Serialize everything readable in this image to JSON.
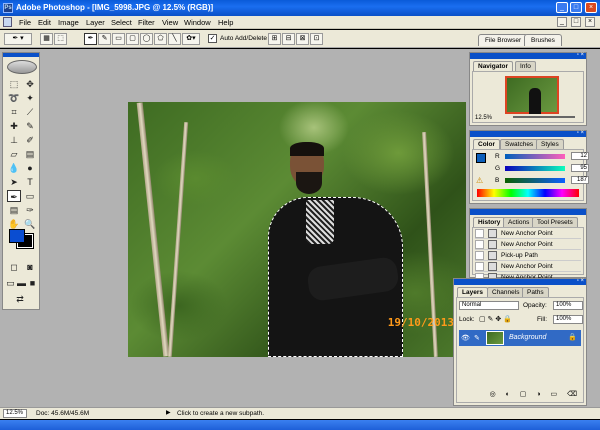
{
  "window": {
    "title": "Adobe Photoshop - [IMG_5998.JPG @ 12.5% (RGB)]",
    "app_icon_letters": "Ps",
    "controls": {
      "minimize": "_",
      "maximize": "□",
      "close": "×"
    }
  },
  "menubar": {
    "items": [
      "File",
      "Edit",
      "Image",
      "Layer",
      "Select",
      "Filter",
      "View",
      "Window",
      "Help"
    ],
    "doc_controls": {
      "minimize": "_",
      "restore": "□",
      "close": "×"
    }
  },
  "options_bar": {
    "auto_add_delete_label": "Auto Add/Delete",
    "auto_add_delete_checked": "✓",
    "palette_well_tabs": [
      "File Browser",
      "Brushes"
    ]
  },
  "canvas": {
    "date_stamp": "19/10/2013"
  },
  "navigator": {
    "tabs": [
      "Navigator",
      "Info"
    ],
    "zoom": "12.5%"
  },
  "color_panel": {
    "tabs": [
      "Color",
      "Swatches",
      "Styles"
    ],
    "channels": [
      {
        "label": "R",
        "value": "12"
      },
      {
        "label": "G",
        "value": "95"
      },
      {
        "label": "B",
        "value": "187"
      }
    ],
    "foreground_color": "#0c5fbb"
  },
  "history_panel": {
    "tabs": [
      "History",
      "Actions",
      "Tool Presets"
    ],
    "items": [
      "New Anchor Point",
      "New Anchor Point",
      "Pick-up Path",
      "New Anchor Point",
      "New Anchor Point"
    ]
  },
  "layers_panel": {
    "tabs": [
      "Layers",
      "Channels",
      "Paths"
    ],
    "blend_mode": "Normal",
    "opacity_label": "Opacity:",
    "opacity_value": "100%",
    "lock_label": "Lock:",
    "fill_label": "Fill:",
    "fill_value": "100%",
    "layers": [
      {
        "name": "Background",
        "visible": true,
        "locked": true
      }
    ],
    "footer_icons": "◎ ◐ ▢ ◑ ▭ ⌫"
  },
  "statusbar": {
    "zoom": "12.5%",
    "doc_info": "Doc: 45.6M/45.6M",
    "hint": "Click to create a new subpath."
  },
  "colors": {
    "titlebar": "#0a5bd8",
    "panel_bg": "#ece9d8",
    "workspace": "#b2b2b2",
    "layer_selected": "#316ac5"
  }
}
